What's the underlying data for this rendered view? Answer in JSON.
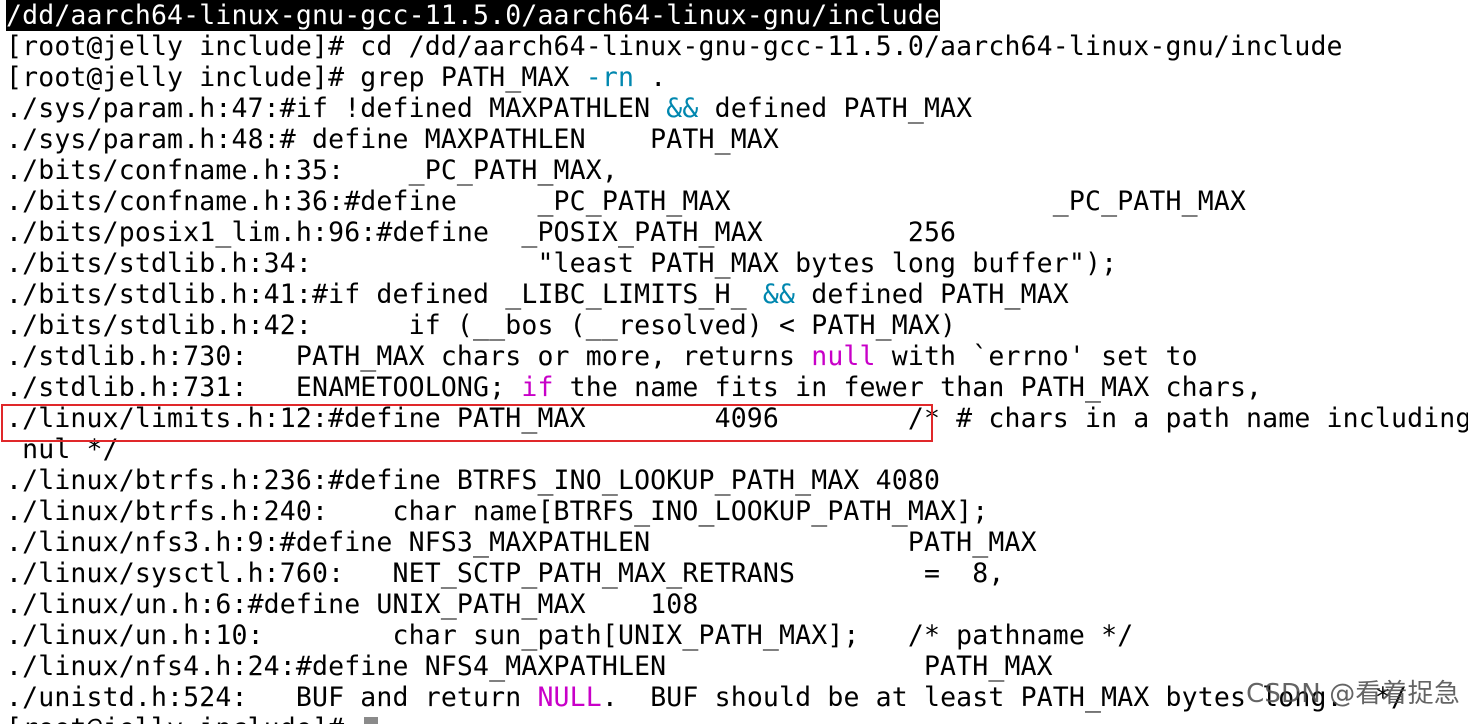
{
  "terminal": {
    "lines": [
      {
        "segments": [
          {
            "text": "/dd/aarch64-linux-gnu-gcc-11.5.0/aarch64-linux-gnu/include",
            "style": "selected"
          }
        ]
      },
      {
        "segments": [
          {
            "text": "[root@jelly include]# cd /dd/aarch64-linux-gnu-gcc-11.5.0/aarch64-linux-gnu/include"
          }
        ]
      },
      {
        "segments": [
          {
            "text": "[root@jelly include]# grep PATH_MAX "
          },
          {
            "text": "-rn",
            "style": "keyword"
          },
          {
            "text": " ."
          }
        ]
      },
      {
        "segments": [
          {
            "text": "./sys/param.h:47:#if !defined MAXPATHLEN "
          },
          {
            "text": "&&",
            "style": "keyword"
          },
          {
            "text": " defined PATH_MAX"
          }
        ]
      },
      {
        "segments": [
          {
            "text": "./sys/param.h:48:# define MAXPATHLEN    PATH_MAX"
          }
        ]
      },
      {
        "segments": [
          {
            "text": "./bits/confname.h:35:    _PC_PATH_MAX,"
          }
        ]
      },
      {
        "segments": [
          {
            "text": "./bits/confname.h:36:#define     _PC_PATH_MAX                    _PC_PATH_MAX"
          }
        ]
      },
      {
        "segments": [
          {
            "text": "./bits/posix1_lim.h:96:#define  _POSIX_PATH_MAX         256"
          }
        ]
      },
      {
        "segments": [
          {
            "text": "./bits/stdlib.h:34:              \"least PATH_MAX bytes long buffer\");"
          }
        ]
      },
      {
        "segments": [
          {
            "text": "./bits/stdlib.h:41:#if defined _LIBC_LIMITS_H_ "
          },
          {
            "text": "&&",
            "style": "keyword"
          },
          {
            "text": " defined PATH_MAX"
          }
        ]
      },
      {
        "segments": [
          {
            "text": "./bits/stdlib.h:42:      if (__bos (__resolved) < PATH_MAX)"
          }
        ]
      },
      {
        "segments": [
          {
            "text": "./stdlib.h:730:   PATH_MAX chars or more, returns "
          },
          {
            "text": "null",
            "style": "magenta"
          },
          {
            "text": " with `errno' set to"
          }
        ]
      },
      {
        "segments": [
          {
            "text": "./stdlib.h:731:   ENAMETOOLONG; "
          },
          {
            "text": "if",
            "style": "magenta"
          },
          {
            "text": " the name fits in fewer than PATH_MAX chars,"
          }
        ]
      },
      {
        "segments": [
          {
            "text": "./linux/limits.h:12:#define PATH_MAX        4096        /* # chars in a path name including"
          }
        ]
      },
      {
        "segments": [
          {
            "text": " nul */"
          }
        ]
      },
      {
        "segments": [
          {
            "text": "./linux/btrfs.h:236:#define BTRFS_INO_LOOKUP_PATH_MAX 4080"
          }
        ]
      },
      {
        "segments": [
          {
            "text": "./linux/btrfs.h:240:    char name[BTRFS_INO_LOOKUP_PATH_MAX];"
          }
        ]
      },
      {
        "segments": [
          {
            "text": "./linux/nfs3.h:9:#define NFS3_MAXPATHLEN                PATH_MAX"
          }
        ]
      },
      {
        "segments": [
          {
            "text": "./linux/sysctl.h:760:   NET_SCTP_PATH_MAX_RETRANS        =  8,"
          }
        ]
      },
      {
        "segments": [
          {
            "text": "./linux/un.h:6:#define UNIX_PATH_MAX    108"
          }
        ]
      },
      {
        "segments": [
          {
            "text": "./linux/un.h:10:        char sun_path[UNIX_PATH_MAX];   /* pathname */"
          }
        ]
      },
      {
        "segments": [
          {
            "text": "./linux/nfs4.h:24:#define NFS4_MAXPATHLEN                PATH_MAX"
          }
        ]
      },
      {
        "segments": [
          {
            "text": "./unistd.h:524:   BUF and return "
          },
          {
            "text": "NULL",
            "style": "magenta"
          },
          {
            "text": ".  BUF should be at least PATH_MAX bytes long.  */"
          }
        ]
      },
      {
        "segments": [
          {
            "text": "[root@jelly include]# "
          }
        ],
        "cursor": true
      }
    ]
  },
  "watermark": "CSDN @看着捉急",
  "colors": {
    "background": "#ffffff",
    "text": "#000000",
    "keyword": "#0087af",
    "magenta": "#c800c8",
    "highlight_box": "#e0282a"
  }
}
